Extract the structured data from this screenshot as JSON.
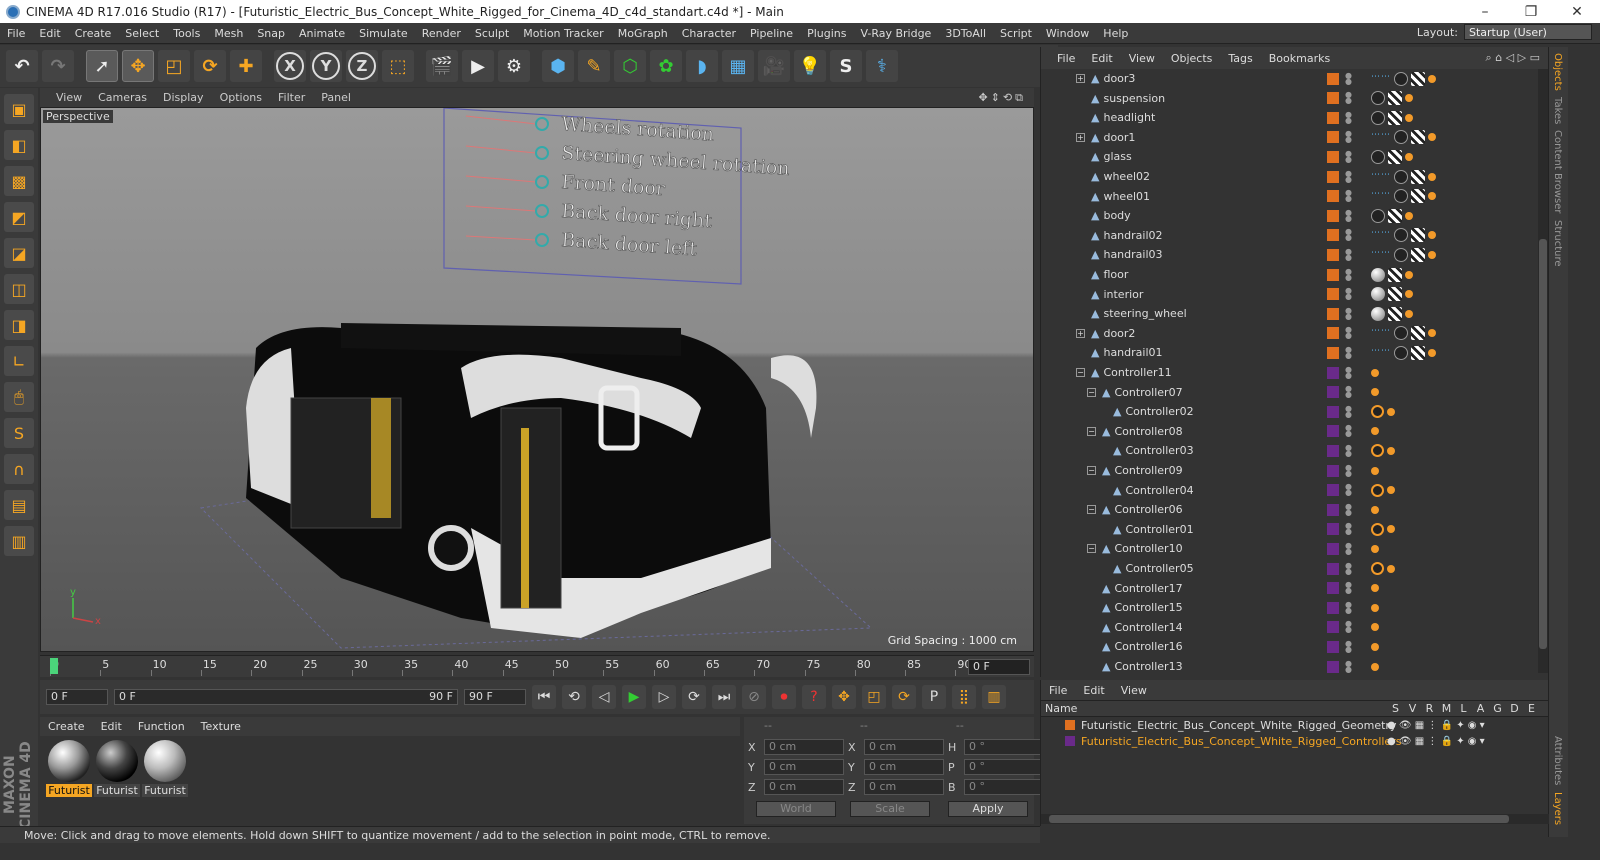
{
  "window": {
    "title": "CINEMA 4D R17.016 Studio (R17) - [Futuristic_Electric_Bus_Concept_White_Rigged_for_Cinema_4D_c4d_standart.c4d *] - Main",
    "min": "–",
    "max": "❐",
    "close": "✕"
  },
  "menu": [
    "File",
    "Edit",
    "Create",
    "Select",
    "Tools",
    "Mesh",
    "Snap",
    "Animate",
    "Simulate",
    "Render",
    "Sculpt",
    "Motion Tracker",
    "MoGraph",
    "Character",
    "Pipeline",
    "Plugins",
    "V-Ray Bridge",
    "3DToAll",
    "Script",
    "Window",
    "Help"
  ],
  "layout": {
    "label": "Layout:",
    "value": "Startup (User)"
  },
  "viewport": {
    "menu": [
      "View",
      "Cameras",
      "Display",
      "Options",
      "Filter",
      "Panel"
    ],
    "label": "Perspective",
    "grid_spacing": "Grid Spacing : 1000 cm",
    "controls": [
      "Wheels rotation",
      "Steering wheel rotation",
      "Front door",
      "Back door right",
      "Back door left"
    ],
    "axis_y": "y",
    "axis_x": "x"
  },
  "timeline": {
    "ticks": [
      "0",
      "5",
      "10",
      "15",
      "20",
      "25",
      "30",
      "35",
      "40",
      "45",
      "50",
      "55",
      "60",
      "65",
      "70",
      "75",
      "80",
      "85",
      "90"
    ],
    "current": "0 F"
  },
  "transport": {
    "start": "0 F",
    "range_start": "0 F",
    "range_end": "90 F",
    "end": "90 F"
  },
  "materials": {
    "menu": [
      "Create",
      "Edit",
      "Function",
      "Texture"
    ],
    "items": [
      "Futurist",
      "Futurist",
      "Futurist"
    ]
  },
  "coords": {
    "header": [
      "--",
      "--",
      "--"
    ],
    "rows": [
      {
        "a": "X",
        "av": "0 cm",
        "b": "X",
        "bv": "0 cm",
        "c": "H",
        "cv": "0 °"
      },
      {
        "a": "Y",
        "av": "0 cm",
        "b": "Y",
        "bv": "0 cm",
        "c": "P",
        "cv": "0 °"
      },
      {
        "a": "Z",
        "av": "0 cm",
        "b": "Z",
        "bv": "0 cm",
        "c": "B",
        "cv": "0 °"
      }
    ],
    "mode": "World",
    "scale": "Scale",
    "apply": "Apply"
  },
  "status": "Move: Click and drag to move elements. Hold down SHIFT to quantize movement / add to the selection in point mode, CTRL to remove.",
  "objects": {
    "menu": [
      "File",
      "Edit",
      "View",
      "Objects",
      "Tags",
      "Bookmarks"
    ],
    "rows": [
      {
        "name": "door3",
        "lvl": 1,
        "exp": "+",
        "color": "#e07020",
        "tags": [
          "bl",
          "ph",
          "ck",
          "dt"
        ]
      },
      {
        "name": "suspension",
        "lvl": 1,
        "exp": "",
        "color": "#e07020",
        "tags": [
          "ph",
          "ck",
          "dt"
        ]
      },
      {
        "name": "headlight",
        "lvl": 1,
        "exp": "",
        "color": "#e07020",
        "tags": [
          "ph",
          "ck",
          "dt"
        ]
      },
      {
        "name": "door1",
        "lvl": 1,
        "exp": "+",
        "color": "#e07020",
        "tags": [
          "bl",
          "ph",
          "ck",
          "dt"
        ]
      },
      {
        "name": "glass",
        "lvl": 1,
        "exp": "",
        "color": "#e07020",
        "tags": [
          "ph",
          "ck",
          "dt"
        ]
      },
      {
        "name": "wheel02",
        "lvl": 1,
        "exp": "",
        "color": "#e07020",
        "tags": [
          "bl",
          "ph",
          "ck",
          "dt"
        ]
      },
      {
        "name": "wheel01",
        "lvl": 1,
        "exp": "",
        "color": "#e07020",
        "tags": [
          "bl",
          "ph",
          "ck",
          "dt"
        ]
      },
      {
        "name": "body",
        "lvl": 1,
        "exp": "",
        "color": "#e07020",
        "tags": [
          "ph",
          "ck",
          "dt"
        ]
      },
      {
        "name": "handrail02",
        "lvl": 1,
        "exp": "",
        "color": "#e07020",
        "tags": [
          "bl",
          "ph",
          "ck",
          "dt"
        ]
      },
      {
        "name": "handrail03",
        "lvl": 1,
        "exp": "",
        "color": "#e07020",
        "tags": [
          "bl",
          "ph",
          "ck",
          "dt"
        ]
      },
      {
        "name": "floor",
        "lvl": 1,
        "exp": "",
        "color": "#e07020",
        "tags": [
          "sp",
          "ck",
          "dt"
        ]
      },
      {
        "name": "interior",
        "lvl": 1,
        "exp": "",
        "color": "#e07020",
        "tags": [
          "sp",
          "ck",
          "dt"
        ]
      },
      {
        "name": "steering_wheel",
        "lvl": 1,
        "exp": "",
        "color": "#e07020",
        "tags": [
          "sp",
          "ck",
          "dt"
        ]
      },
      {
        "name": "door2",
        "lvl": 1,
        "exp": "+",
        "color": "#e07020",
        "tags": [
          "bl",
          "ph",
          "ck",
          "dt"
        ]
      },
      {
        "name": "handrail01",
        "lvl": 1,
        "exp": "",
        "color": "#e07020",
        "tags": [
          "bl",
          "ph",
          "ck",
          "dt"
        ]
      },
      {
        "name": "Controller11",
        "lvl": 1,
        "exp": "−",
        "color": "#6a2a8a",
        "tags": [
          "dt"
        ]
      },
      {
        "name": "Controller07",
        "lvl": 2,
        "exp": "−",
        "color": "#6a2a8a",
        "tags": [
          "dt"
        ]
      },
      {
        "name": "Controller02",
        "lvl": 3,
        "exp": "",
        "color": "#6a2a8a",
        "tags": [
          "no",
          "dt"
        ]
      },
      {
        "name": "Controller08",
        "lvl": 2,
        "exp": "−",
        "color": "#6a2a8a",
        "tags": [
          "dt"
        ]
      },
      {
        "name": "Controller03",
        "lvl": 3,
        "exp": "",
        "color": "#6a2a8a",
        "tags": [
          "no",
          "dt"
        ]
      },
      {
        "name": "Controller09",
        "lvl": 2,
        "exp": "−",
        "color": "#6a2a8a",
        "tags": [
          "dt"
        ]
      },
      {
        "name": "Controller04",
        "lvl": 3,
        "exp": "",
        "color": "#6a2a8a",
        "tags": [
          "no",
          "dt"
        ]
      },
      {
        "name": "Controller06",
        "lvl": 2,
        "exp": "−",
        "color": "#6a2a8a",
        "tags": [
          "dt"
        ]
      },
      {
        "name": "Controller01",
        "lvl": 3,
        "exp": "",
        "color": "#6a2a8a",
        "tags": [
          "no",
          "dt"
        ]
      },
      {
        "name": "Controller10",
        "lvl": 2,
        "exp": "−",
        "color": "#6a2a8a",
        "tags": [
          "dt"
        ]
      },
      {
        "name": "Controller05",
        "lvl": 3,
        "exp": "",
        "color": "#6a2a8a",
        "tags": [
          "no",
          "dt"
        ]
      },
      {
        "name": "Controller17",
        "lvl": 2,
        "exp": "",
        "color": "#6a2a8a",
        "tags": [
          "dt"
        ]
      },
      {
        "name": "Controller15",
        "lvl": 2,
        "exp": "",
        "color": "#6a2a8a",
        "tags": [
          "dt"
        ]
      },
      {
        "name": "Controller14",
        "lvl": 2,
        "exp": "",
        "color": "#6a2a8a",
        "tags": [
          "dt"
        ]
      },
      {
        "name": "Controller16",
        "lvl": 2,
        "exp": "",
        "color": "#6a2a8a",
        "tags": [
          "dt"
        ]
      },
      {
        "name": "Controller13",
        "lvl": 2,
        "exp": "",
        "color": "#6a2a8a",
        "tags": [
          "dt"
        ]
      }
    ]
  },
  "layers": {
    "menu": [
      "File",
      "Edit",
      "View"
    ],
    "header": "Name",
    "cols": [
      "S",
      "V",
      "R",
      "M",
      "L",
      "A",
      "G",
      "D",
      "E"
    ],
    "items": [
      {
        "name": "Futuristic_Electric_Bus_Concept_White_Rigged_Geometry",
        "color": "#e07020",
        "active": false
      },
      {
        "name": "Futuristic_Electric_Bus_Concept_White_Rigged_Controllers",
        "color": "#6a2a8a",
        "active": true
      }
    ]
  },
  "sidetabs": [
    "Objects",
    "Takes",
    "Content Browser",
    "Structure",
    "Attributes",
    "Layers"
  ],
  "colors": {
    "accent": "#f5a623",
    "bg": "#333333",
    "panel": "#3a3a3a"
  }
}
